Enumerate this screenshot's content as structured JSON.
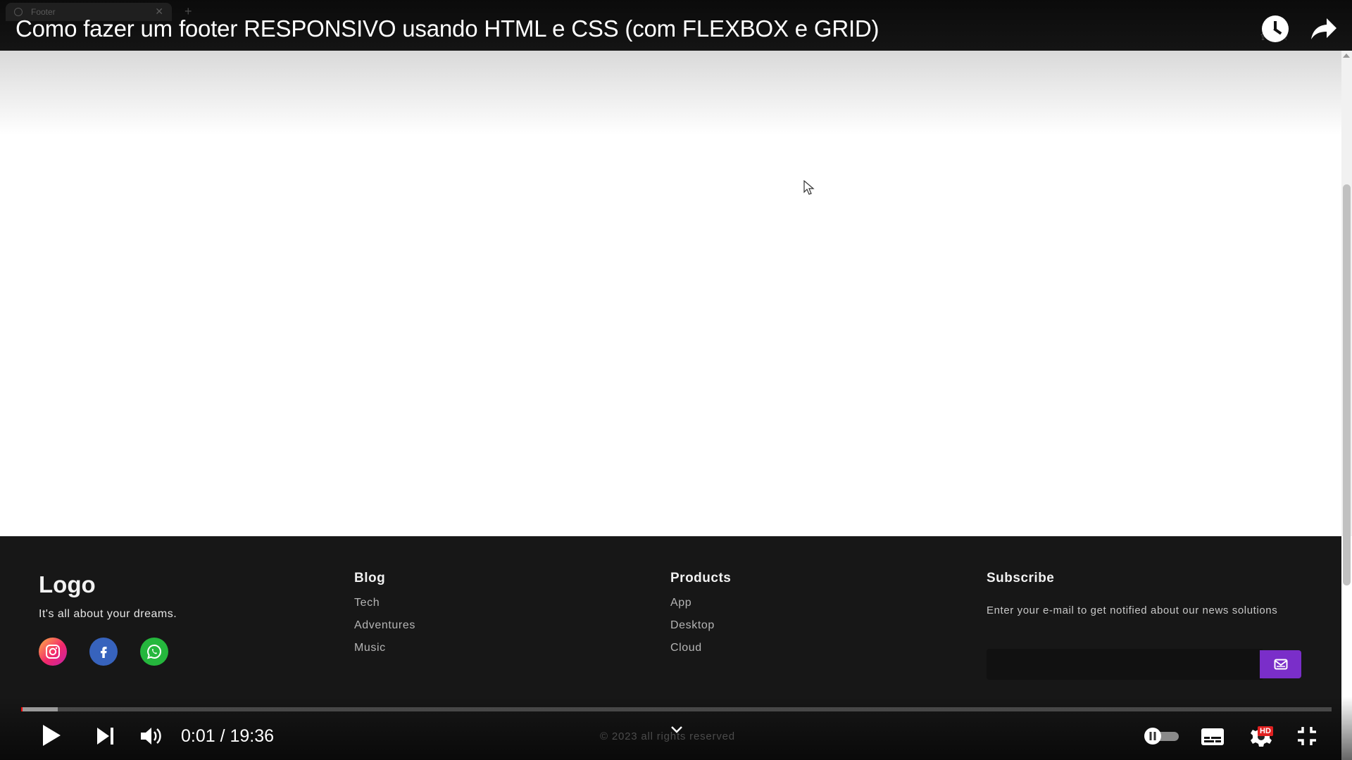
{
  "browser": {
    "tab_title": "Footer"
  },
  "video": {
    "title": "Como fazer um footer RESPONSIVO usando HTML e CSS (com FLEXBOX e GRID)",
    "current_time": "0:01",
    "duration": "19:36",
    "time_display": "0:01 / 19:36",
    "progress_played": 0.0009,
    "progress_buffered": 0.028,
    "quality_badge": "HD"
  },
  "footer": {
    "logo": "Logo",
    "tagline": "It's all about your dreams.",
    "social": [
      {
        "icon": "instagram-icon",
        "color": "#e4405f"
      },
      {
        "icon": "facebook-icon",
        "color": "#3763bd"
      },
      {
        "icon": "whatsapp-icon",
        "color": "#25b73d"
      }
    ],
    "blog": {
      "title": "Blog",
      "links": [
        "Tech",
        "Adventures",
        "Music"
      ]
    },
    "products": {
      "title": "Products",
      "links": [
        "App",
        "Desktop",
        "Cloud"
      ]
    },
    "subscribe": {
      "title": "Subscribe",
      "text": "Enter your e-mail to get notified about our news solutions",
      "button_color": "#7a2ec9"
    },
    "copyright": "© 2023 all rights reserved"
  },
  "colors": {
    "footer_bg": "#171717",
    "progress_red": "#ff0000",
    "accent_purple": "#7a2ec9"
  }
}
